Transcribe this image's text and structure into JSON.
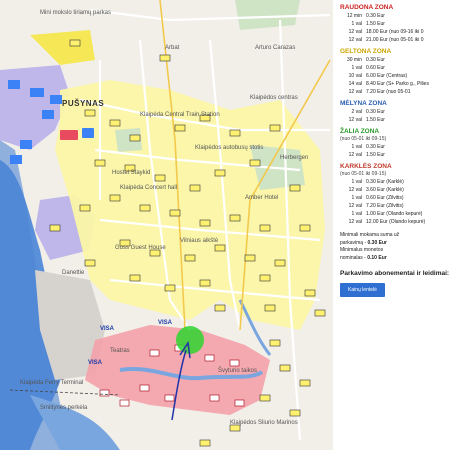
{
  "map": {
    "district_label": "PUŠYNAS",
    "place_labels": [
      "Mini mokslo tiriamų parkas",
      "Arbat",
      "Arturo Carazas",
      "Klaipėdos centras",
      "Klaipėda Central Train Station",
      "Klaipėdos autobusų stotis",
      "Hostel Staykid",
      "Klaipėda Concert hall",
      "Herbergen",
      "Vilniaus aikštė",
      "Amber Hotel",
      "Guss Guest House",
      "Danettie",
      "Teatras",
      "Klaipėda Ferry Terminal",
      "Klaipėdos Sliurio Marinos",
      "Švyturio taikos",
      "Smiltynės perkėla"
    ],
    "badges": [
      "VISA",
      "VISA",
      "VISA"
    ]
  },
  "legend": {
    "zones": [
      {
        "title": "RAUDONA ZONA",
        "color": "#cc2222",
        "sub": "",
        "rows": [
          {
            "d": "12 min",
            "p": "0.30 Eur"
          },
          {
            "d": "1 val",
            "p": "1.50 Eur"
          },
          {
            "d": "12 val",
            "p": "18.00 Eur (nuo 09-16 iki 0"
          },
          {
            "d": "12 val",
            "p": "21.00 Eur (nuo 05-01 iki 0"
          }
        ]
      },
      {
        "title": "GELTONA ZONA",
        "color": "#cca600",
        "sub": "",
        "rows": [
          {
            "d": "30 min",
            "p": "0.30 Eur"
          },
          {
            "d": "1 val",
            "p": "0.60 Eur"
          },
          {
            "d": "10 val",
            "p": "6.00 Eur (Centras)"
          },
          {
            "d": "14 val",
            "p": "8.40 Eur (S+ Parko g., Pilies"
          },
          {
            "d": "12 val",
            "p": "7.20 Eur (nuo 05-01"
          }
        ]
      },
      {
        "title": "MĖLYNA ZONA",
        "color": "#2a5db0",
        "sub": "",
        "rows": [
          {
            "d": "2 val",
            "p": "0.30 Eur"
          },
          {
            "d": "12 val",
            "p": "1.50 Eur"
          }
        ]
      },
      {
        "title": "ŽALIA ZONA",
        "color": "#2a9a2a",
        "sub": "(nuo 05-01 iki 09-15)",
        "rows": [
          {
            "d": "1 val",
            "p": "0.30 Eur"
          },
          {
            "d": "12 val",
            "p": "1.50 Eur"
          }
        ]
      },
      {
        "title": "KARKLĖS ZONA",
        "color": "#c0392b",
        "sub": "(nuo 05-01 iki 09-15)",
        "rows": [
          {
            "d": "1 val",
            "p": "0.30 Eur (Karklė)"
          },
          {
            "d": "12 val",
            "p": "3.60 Eur (Karklė)"
          },
          {
            "d": "1 val",
            "p": "0.60 Eur (Žilvitis)"
          },
          {
            "d": "12 val",
            "p": "7.20 Eur (Žilvitis)"
          },
          {
            "d": "1 val",
            "p": "1.00 Eur (Olando kepurė)"
          },
          {
            "d": "12 val",
            "p": "12.00 Eur (Olando kepurė)"
          }
        ]
      }
    ],
    "min_sum_1": "Minimali mokama suma už",
    "min_sum_2": "parkavimą - ",
    "min_sum_value": "0.30 Eur",
    "min_coin_1": "Minimalus monetos",
    "min_coin_2": "nominalas - ",
    "min_coin_value": "0.10 Eur",
    "subscription_title": "Parkavimo abonementai ir leidimai:",
    "button_label": "Kainų lentelė"
  }
}
